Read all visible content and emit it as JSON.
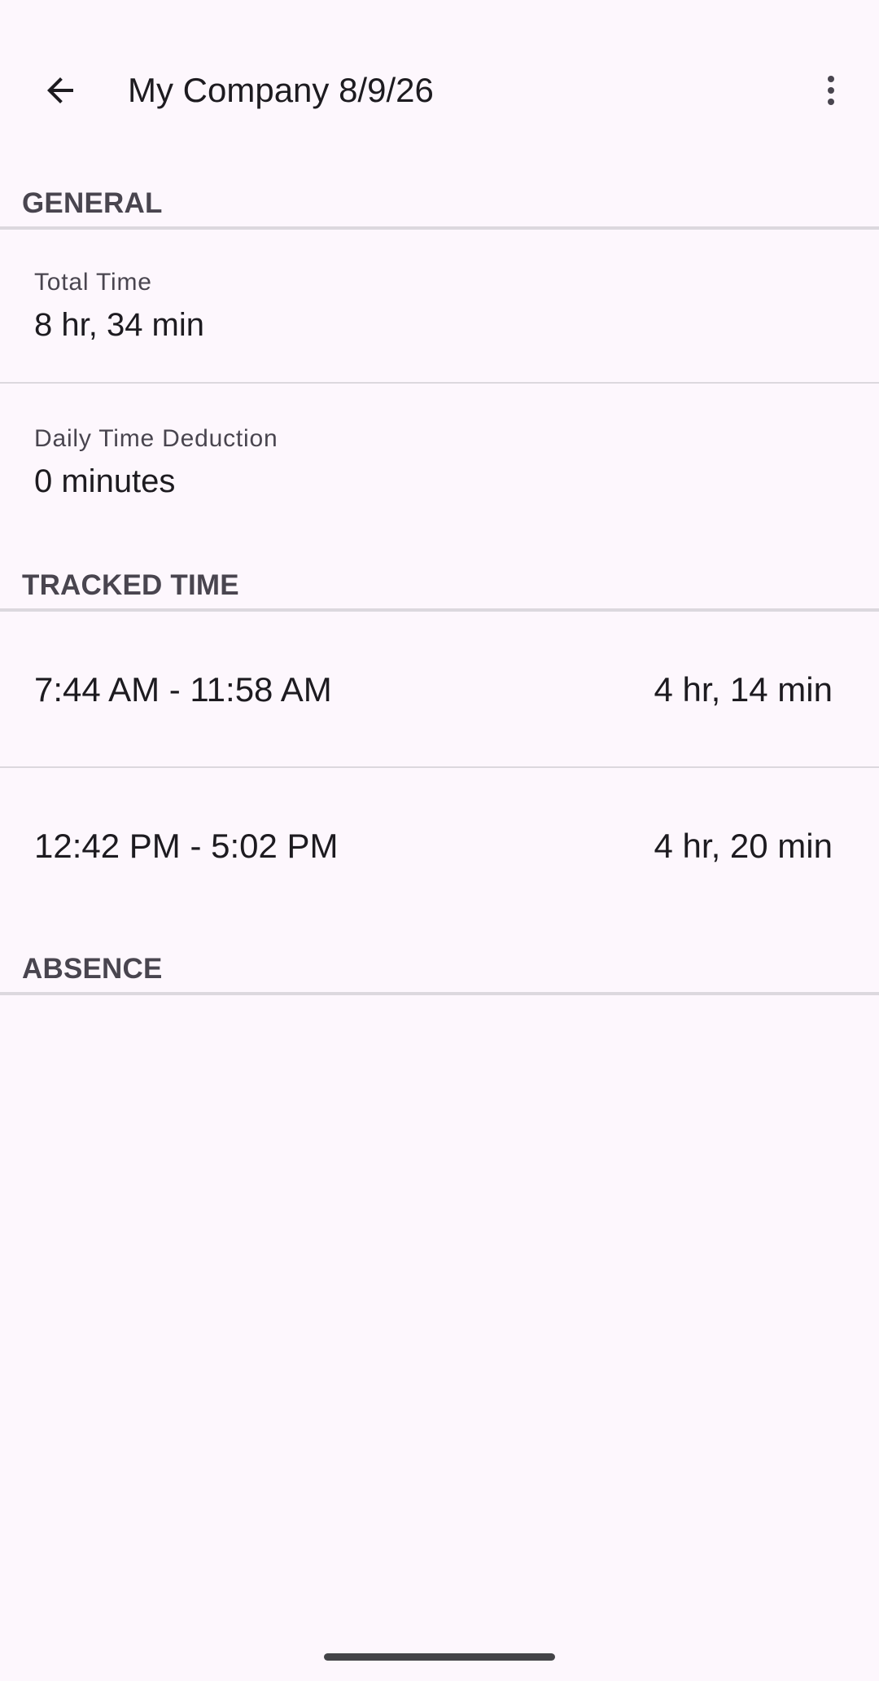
{
  "app_bar": {
    "title": "My Company 8/9/26",
    "back_icon": "arrow-back-icon",
    "more_icon": "more-vert-icon"
  },
  "sections": {
    "general": "GENERAL",
    "tracked_time": "TRACKED TIME",
    "absence": "ABSENCE"
  },
  "general": {
    "total_time_label": "Total Time",
    "total_time_value": "8 hr, 34 min",
    "deduction_label": "Daily Time Deduction",
    "deduction_value": "0 minutes"
  },
  "tracked_entries": [
    {
      "range": "7:44 AM - 11:58 AM",
      "duration": "4 hr, 14 min"
    },
    {
      "range": "12:42 PM - 5:02 PM",
      "duration": "4 hr, 20 min"
    }
  ],
  "colors": {
    "background": "#fdf7fd",
    "section_text": "#49454f",
    "divider": "#dcd8de",
    "primary_text": "#1d1b20"
  }
}
